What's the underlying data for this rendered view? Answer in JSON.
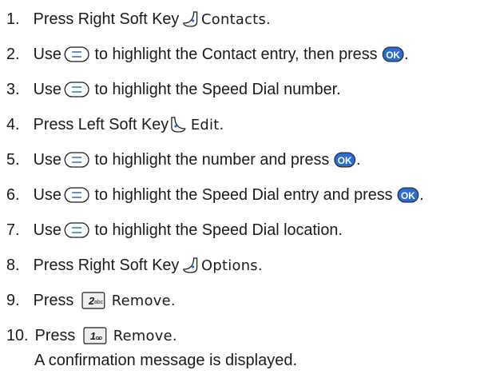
{
  "steps": [
    {
      "num": "1.",
      "pre": "Press Right Soft Key",
      "screen": "Contacts."
    },
    {
      "num": "2.",
      "pre": "Use",
      "text": "to highlight the Contact entry, then press",
      "post": "."
    },
    {
      "num": "3.",
      "pre": "Use",
      "text": "to highlight the Speed Dial number."
    },
    {
      "num": "4.",
      "pre": "Press Left Soft Key",
      "screen": "Edit."
    },
    {
      "num": "5.",
      "pre": "Use",
      "text": "to highlight the number and press",
      "post": "."
    },
    {
      "num": "6.",
      "pre": "Use",
      "text": "to highlight the Speed Dial entry and press",
      "post": "."
    },
    {
      "num": "7.",
      "pre": "Use",
      "text": "to highlight the Speed Dial location."
    },
    {
      "num": "8.",
      "pre": "Press Right Soft Key",
      "screen": "Options."
    },
    {
      "num": "9.",
      "pre": "Press",
      "screen": "Remove."
    },
    {
      "num": "10.",
      "pre": "Press",
      "screen": "Remove.",
      "sub": "A confirmation message is displayed."
    }
  ],
  "icons": {
    "ok_label": "OK",
    "key2_digit": "2",
    "key2_letters": "abc",
    "key1_digit": "1",
    "colors": {
      "ok_fill": "#2a6cd2",
      "nav_ring": "#2a6cd2",
      "soft_ring": "#2a6cd2"
    }
  }
}
